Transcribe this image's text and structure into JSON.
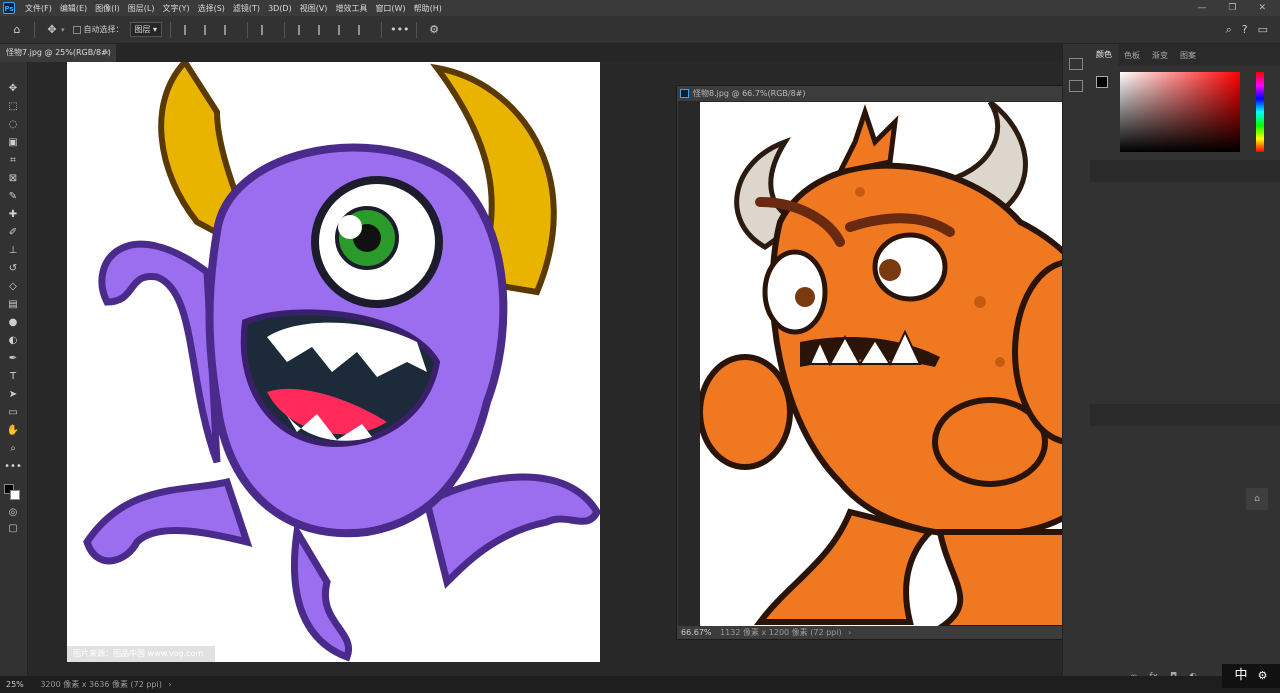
{
  "app": {
    "name": "Ps"
  },
  "menu": [
    "文件(F)",
    "编辑(E)",
    "图像(I)",
    "图层(L)",
    "文字(Y)",
    "选择(S)",
    "滤镜(T)",
    "3D(D)",
    "视图(V)",
    "增效工具",
    "窗口(W)",
    "帮助(H)"
  ],
  "options": {
    "auto_select_label": "自动选择：",
    "auto_select_value": "图层"
  },
  "doc1": {
    "tab": "怪物7.jpg @ 25%(RGB/8#)",
    "watermark": "图片来源：图品中国 www.vog.com",
    "zoom": "25%",
    "info": "3200 像素 x 3636 像素 (72 ppi)"
  },
  "doc2": {
    "title": "怪物8.jpg @ 66.7%(RGB/8#)",
    "zoom": "66.67%",
    "info": "1132 像素 x 1200 像素 (72 ppi)"
  },
  "panels": {
    "tabs": [
      "颜色",
      "色板",
      "渐变",
      "图案"
    ]
  },
  "ime": {
    "label": "中"
  },
  "colors": {
    "purple": "#9b6ef0",
    "purple_dark": "#4a2a8a",
    "orange": "#f07820",
    "gold": "#e8b400"
  }
}
